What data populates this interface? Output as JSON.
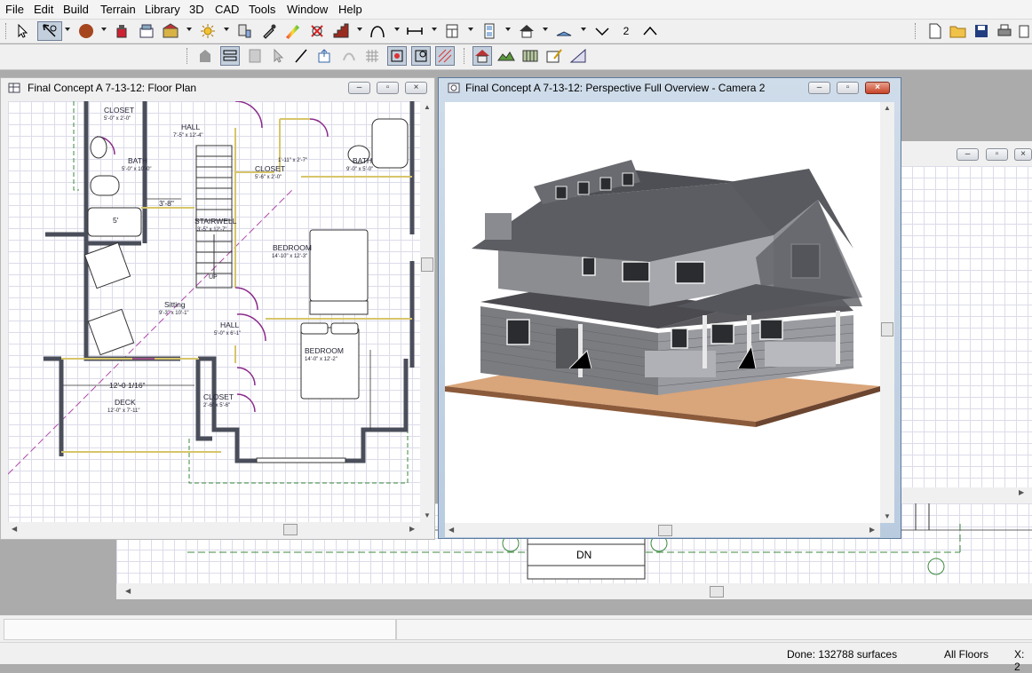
{
  "menu": [
    "File",
    "Edit",
    "Build",
    "Terrain",
    "Library",
    "3D",
    "CAD",
    "Tools",
    "Window",
    "Help"
  ],
  "toolbar": {
    "number_label": "2"
  },
  "windows": {
    "floor_plan_title": "Final Concept A 7-13-12: Floor Plan",
    "camera_title": "Final Concept A 7-13-12: Perspective Full Overview - Camera 2"
  },
  "plan": {
    "closet1": "CLOSET",
    "closet1_dim": "5'-0\" x 2'-0\"",
    "hall1": "HALL",
    "hall1_dim": "7'-5\" x 12'-4\"",
    "bath1": "BATH",
    "bath1_dim": "5'-0\" x 10'-0\"",
    "closet2": "CLOSET",
    "closet2_dim": "5'-6\" x 2'-0\"",
    "dim_small": "1'-11\" x 2'-7\"",
    "bath2": "BATH",
    "bath2_dim": "9'-0\" x 5'-0\"",
    "dim_3_8": "3'-8\"",
    "tub_width": "5'",
    "stairwell": "STAIRWELL",
    "stairwell_dim": "3'-5\" x 12'-7\"",
    "bedroom1": "BEDROOM",
    "bedroom1_dim": "14'-10\" x 12'-3\"",
    "up": "UP",
    "sitting": "Sitting",
    "sitting_dim": "9'-3\" x 10'-1\"",
    "hall2": "HALL",
    "hall2_dim": "5'-0\" x 6'-1\"",
    "bedroom2": "BEDROOM",
    "bedroom2_dim": "14'-0\" x 12'-2\"",
    "deck_dim_line": "12'-0 1/16\"",
    "deck": "DECK",
    "deck_dim": "12'-0\" x 7'-11\"",
    "closet3": "CLOSET",
    "closet3_dim": "2'-6\" x 5'-6\""
  },
  "background_plan": {
    "dn_label": "DN"
  },
  "status": {
    "message": "Done:  132788 surfaces",
    "floors": "All Floors",
    "coord": "X: 2"
  },
  "icons": [
    "select-icon",
    "edit-tool-icon",
    "material-icon",
    "build-icon",
    "camera-icon",
    "light-icon",
    "cad-icon",
    "stair-icon",
    "door-icon",
    "window-icon",
    "roof-icon",
    "dimension-icon",
    "new-file-icon",
    "open-folder-icon",
    "save-icon",
    "print-icon"
  ]
}
